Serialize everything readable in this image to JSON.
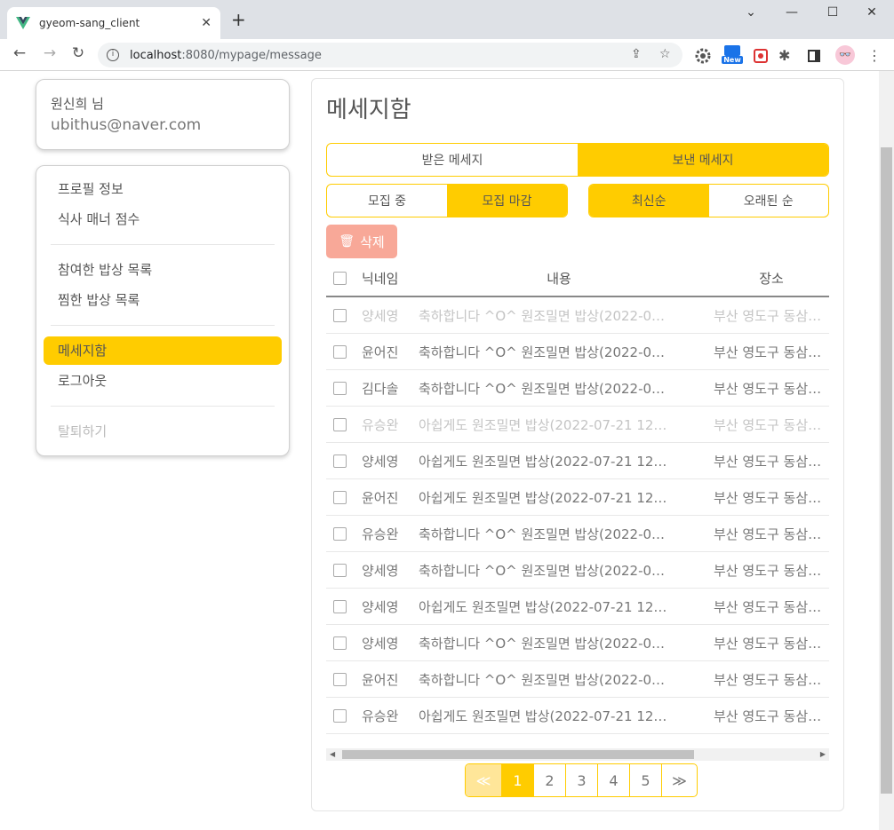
{
  "browser": {
    "tab_title": "gyeom-sang_client",
    "tab_close": "✕",
    "new_tab": "+",
    "url_host": "localhost",
    "url_path": ":8080/mypage/message",
    "ext_badge": "New"
  },
  "user": {
    "name": "원신희 님",
    "email": "ubithus@naver.com"
  },
  "menu": {
    "group1": [
      "프로필 정보",
      "식사 매너 점수"
    ],
    "group2": [
      "참여한 밥상 목록",
      "찜한 밥상 목록"
    ],
    "group3": [
      "메세지함",
      "로그아웃"
    ],
    "group4": [
      "탈퇴하기"
    ],
    "active": "메세지함"
  },
  "main": {
    "title": "메세지함",
    "box_tabs": [
      "받은 메세지",
      "보낸 메세지"
    ],
    "status_tabs": [
      "모집 중",
      "모집 마감"
    ],
    "sort_tabs": [
      "최신순",
      "오래된 순"
    ],
    "delete_label": "삭제",
    "columns": [
      "닉네임",
      "내용",
      "장소"
    ],
    "rows": [
      {
        "nick": "양세영",
        "content": "축하합니다 ^O^ 원조밀면 밥상(2022-0…",
        "place": "부산 영도구 동삼…",
        "read": true
      },
      {
        "nick": "윤어진",
        "content": "축하합니다 ^O^ 원조밀면 밥상(2022-0…",
        "place": "부산 영도구 동삼…",
        "read": false
      },
      {
        "nick": "김다솔",
        "content": "축하합니다 ^O^ 원조밀면 밥상(2022-0…",
        "place": "부산 영도구 동삼…",
        "read": false
      },
      {
        "nick": "유승완",
        "content": "아쉽게도 원조밀면 밥상(2022-07-21 12…",
        "place": "부산 영도구 동삼…",
        "read": true
      },
      {
        "nick": "양세영",
        "content": "아쉽게도 원조밀면 밥상(2022-07-21 12…",
        "place": "부산 영도구 동삼…",
        "read": false
      },
      {
        "nick": "윤어진",
        "content": "아쉽게도 원조밀면 밥상(2022-07-21 12…",
        "place": "부산 영도구 동삼…",
        "read": false
      },
      {
        "nick": "유승완",
        "content": "축하합니다 ^O^ 원조밀면 밥상(2022-0…",
        "place": "부산 영도구 동삼…",
        "read": false
      },
      {
        "nick": "양세영",
        "content": "축하합니다 ^O^ 원조밀면 밥상(2022-0…",
        "place": "부산 영도구 동삼…",
        "read": false
      },
      {
        "nick": "양세영",
        "content": "아쉽게도 원조밀면 밥상(2022-07-21 12…",
        "place": "부산 영도구 동삼…",
        "read": false
      },
      {
        "nick": "양세영",
        "content": "축하합니다 ^O^ 원조밀면 밥상(2022-0…",
        "place": "부산 영도구 동삼…",
        "read": false
      },
      {
        "nick": "윤어진",
        "content": "축하합니다 ^O^ 원조밀면 밥상(2022-0…",
        "place": "부산 영도구 동삼…",
        "read": false
      },
      {
        "nick": "유승완",
        "content": "아쉽게도 원조밀면 밥상(2022-07-21 12…",
        "place": "부산 영도구 동삼…",
        "read": false
      }
    ],
    "pagination": {
      "prev": "≪",
      "pages": [
        "1",
        "2",
        "3",
        "4",
        "5"
      ],
      "next": "≫",
      "current": "1"
    }
  },
  "colors": {
    "accent": "#ffcc00",
    "delete": "#f8a898"
  }
}
